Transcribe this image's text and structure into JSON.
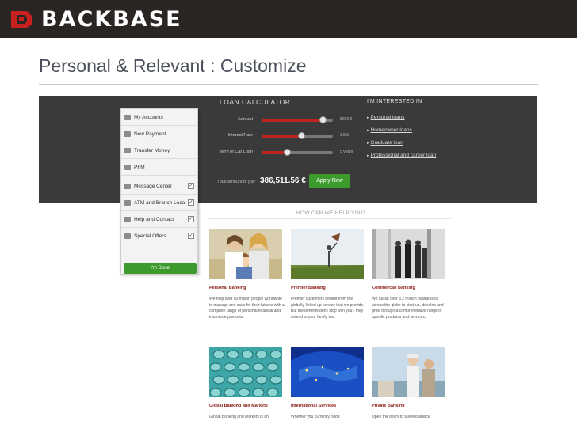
{
  "header": {
    "brand": "BACKBASE",
    "logo_icon": "backbase-logo-icon"
  },
  "slide": {
    "title": "Personal & Relevant : Customize"
  },
  "menu": {
    "items": [
      {
        "label": "My Accounts",
        "icon": "accounts-icon",
        "checkbox": false
      },
      {
        "label": "New Payment",
        "icon": "payment-icon",
        "checkbox": false
      },
      {
        "label": "Transfer Money",
        "icon": "transfer-icon",
        "checkbox": false
      },
      {
        "label": "PFM",
        "icon": "pfm-icon",
        "checkbox": false
      },
      {
        "label": "Message Center",
        "icon": "message-icon",
        "checkbox": true
      },
      {
        "label": "ATM and Branch Loca",
        "icon": "atm-icon",
        "checkbox": true
      },
      {
        "label": "Help and Contact",
        "icon": "help-icon",
        "checkbox": true
      },
      {
        "label": "Special Offers",
        "icon": "offers-icon",
        "checkbox": true
      }
    ],
    "done_label": "I'm Done"
  },
  "loan_calculator": {
    "title": "LOAN CALCULATOR",
    "amount_label": "Amount",
    "amount_value": "5000 €",
    "amount_level": 0.85,
    "rate_label": "Interest Rate",
    "rate_value": "3,5%",
    "rate_level": 0.55,
    "term_label": "Term of Car Loan",
    "term_value": "5 years",
    "term_level": 0.35,
    "total_label": "Total amount to pay",
    "total_value": "386,511.56 €",
    "apply_label": "Apply Now"
  },
  "interests": {
    "title": "I'M INTERESTED IN",
    "links": [
      "Personal loans",
      "Homeowner loans",
      "Graduate loan",
      "Professional and career loan"
    ]
  },
  "help": {
    "title": "HOW CAN WE HELP YOU?",
    "cards": [
      {
        "title": "Personal Banking",
        "text": "We help over 50 million people worldwide to manage and save for their futures with a complete range of personal financial and insurance products."
      },
      {
        "title": "Premier Banking",
        "text": "Premier customers benefit from the globally-linked up service that we provide. But the benefits don't stop with you - they extend to your family too."
      },
      {
        "title": "Commercial Banking",
        "text": "We assist over 3.2 million businesses across the globe to start-up, develop and grow through a comprehensive range of specific products and services."
      },
      {
        "title": "Global Banking and Markets",
        "text": "Global Banking and Markets is an"
      },
      {
        "title": "International Services",
        "text": "Whether you currently trade"
      },
      {
        "title": "Private Banking",
        "text": "Open the doors to tailored advice"
      }
    ]
  },
  "colors": {
    "header_bg": "#2b2623",
    "accent_red": "#c0231e",
    "accent_green": "#3d9b2e",
    "card_title": "#8a1a14"
  }
}
